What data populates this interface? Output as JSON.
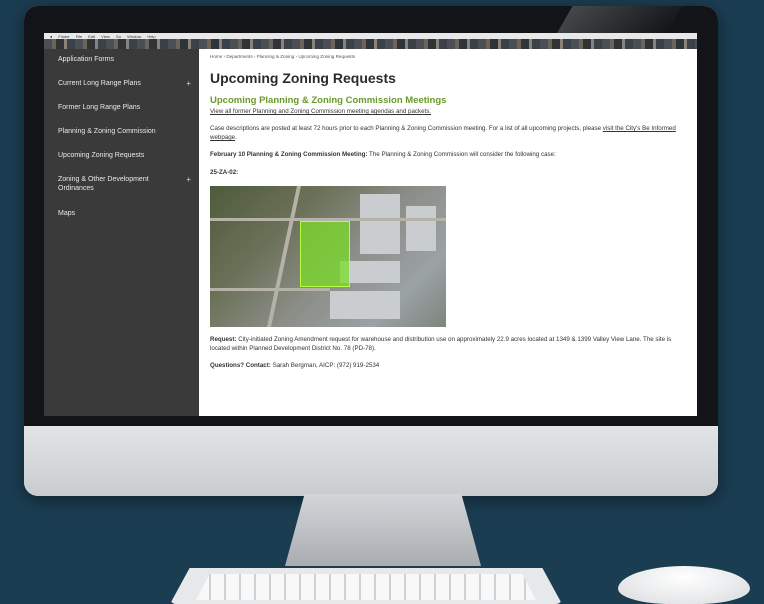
{
  "menubar": {
    "items": [
      "Finder",
      "File",
      "Edit",
      "View",
      "Go",
      "Window",
      "Help"
    ]
  },
  "sidebar": {
    "items": [
      {
        "label": "Application Forms",
        "expandable": false
      },
      {
        "label": "Current Long Range Plans",
        "expandable": true
      },
      {
        "label": "Former Long Range Plans",
        "expandable": false
      },
      {
        "label": "Planning & Zoning Commission",
        "expandable": false
      },
      {
        "label": "Upcoming Zoning Requests",
        "expandable": false
      },
      {
        "label": "Zoning & Other Development Ordinances",
        "expandable": true
      },
      {
        "label": "Maps",
        "expandable": false
      }
    ],
    "expand_glyph": "+"
  },
  "main": {
    "breadcrumb": "Home › Departments › Planning & Zoning › Upcoming Zoning Requests",
    "page_title": "Upcoming Zoning Requests",
    "section_title": "Upcoming Planning & Zoning Commission Meetings",
    "view_all_link": "View all former Planning and Zoning Commission meeting agendas and packets.",
    "case_desc_text": "Case descriptions are posted at least 72 hours prior to each Planning & Zoning Commission meeting. For a list of all upcoming projects, please ",
    "case_desc_link": "visit the City's Be Informed webpage",
    "case_desc_end": ".",
    "meeting_label": "February 10 Planning & Zoning Commission Meeting:",
    "meeting_text": " The Planning & Zoning Commission will consider the following case:",
    "case_id": "25-ZA-02:",
    "request_label": "Request:",
    "request_text": " City-initiated Zoning Amendment request for warehouse and distribution use on approximately 22.9 acres located at 1349 & 1399 Valley View Lane. The site is located within Planned Development District No. 78 (PD-78).",
    "contact_label": "Questions? Contact:",
    "contact_text": " Sarah Bergman, AICP: (972) 919-2534"
  },
  "colors": {
    "sidebar_bg": "#3a3a3a",
    "accent_green": "#6a9a2a",
    "background": "#1b3d52"
  }
}
